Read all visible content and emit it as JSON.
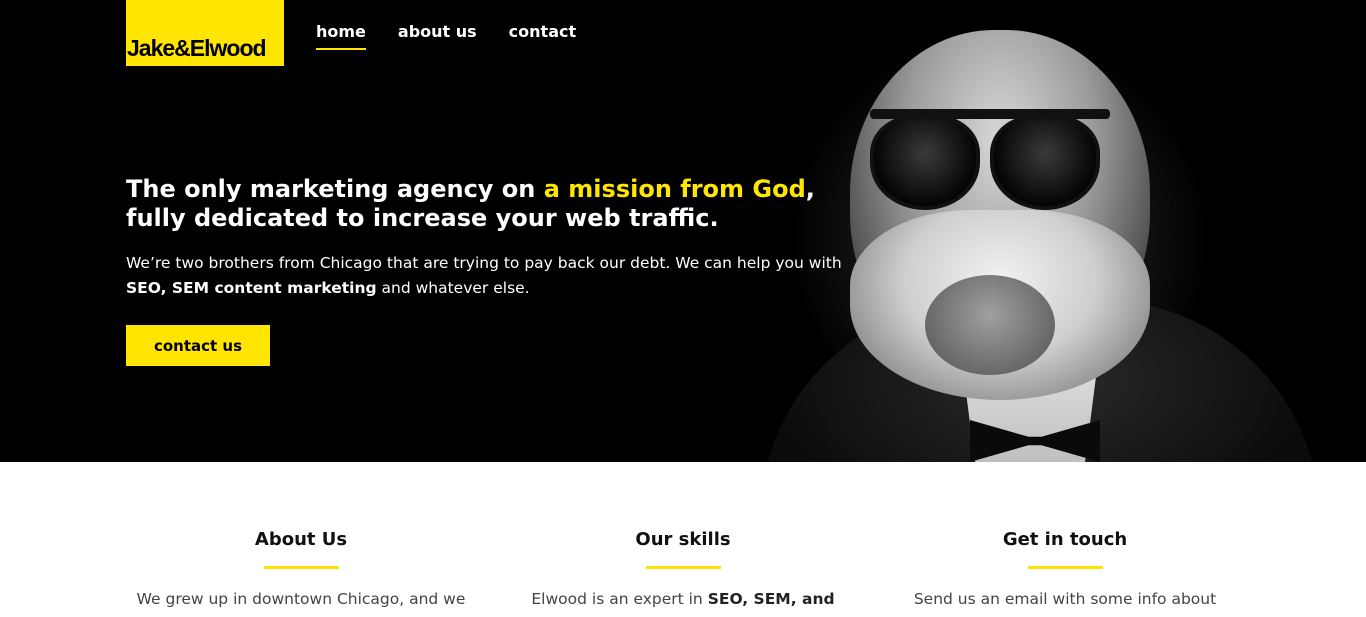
{
  "brand": {
    "logo_text": "Jake&Elwood",
    "accent_color": "#ffe500"
  },
  "nav": {
    "items": [
      {
        "label": "home",
        "active": true
      },
      {
        "label": "about us",
        "active": false
      },
      {
        "label": "contact",
        "active": false
      }
    ]
  },
  "hero": {
    "headline_pre": "The only marketing agency on ",
    "headline_highlight": "a mission from God",
    "headline_post": ", fully dedicated to increase your web traffic.",
    "lead_pre": "We’re two brothers from Chicago that are trying to pay back our debt. We can help you with ",
    "lead_bold": "SEO, SEM content marketing",
    "lead_post": " and whatever else.",
    "cta_label": "contact us",
    "image_description_icon": "portrait-photo"
  },
  "sections": [
    {
      "title": "About Us",
      "text": "We grew up in downtown Chicago, and we",
      "bold": ""
    },
    {
      "title": "Our skills",
      "text": "Elwood is an expert in ",
      "bold": "SEO, SEM, and"
    },
    {
      "title": "Get in touch",
      "text": "Send us an email with some info about",
      "bold": ""
    }
  ]
}
